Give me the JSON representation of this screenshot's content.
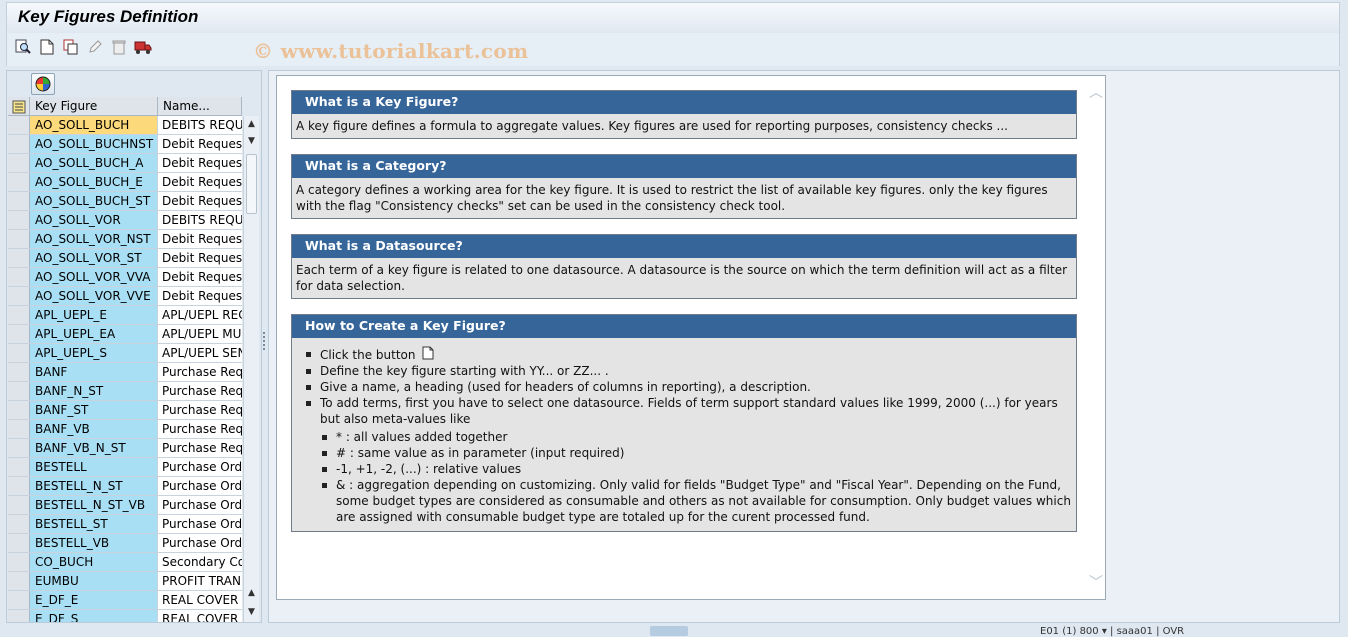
{
  "window": {
    "title": "Key Figures Definition"
  },
  "watermark": "© www.tutorialkart.com",
  "toolbar": {
    "buttons": [
      {
        "name": "find-icon"
      },
      {
        "name": "new-document-icon"
      },
      {
        "name": "copy-icon"
      },
      {
        "name": "edit-pencil-icon"
      },
      {
        "name": "delete-trash-icon"
      },
      {
        "name": "transport-truck-icon"
      }
    ]
  },
  "grid": {
    "columns": [
      "Key Figure",
      "Name..."
    ],
    "rows": [
      {
        "key": "AO_SOLL_BUCH",
        "name": "DEBITS REQU"
      },
      {
        "key": "AO_SOLL_BUCHNST",
        "name": "Debit Request"
      },
      {
        "key": "AO_SOLL_BUCH_A",
        "name": "Debit Request"
      },
      {
        "key": "AO_SOLL_BUCH_E",
        "name": "Debit Request"
      },
      {
        "key": "AO_SOLL_BUCH_ST",
        "name": "Debit Request"
      },
      {
        "key": "AO_SOLL_VOR",
        "name": "DEBITS REQU"
      },
      {
        "key": "AO_SOLL_VOR_NST",
        "name": "Debit Request"
      },
      {
        "key": "AO_SOLL_VOR_ST",
        "name": "Debit Request"
      },
      {
        "key": "AO_SOLL_VOR_VVA",
        "name": "Debit Request"
      },
      {
        "key": "AO_SOLL_VOR_VVE",
        "name": "Debit Request"
      },
      {
        "key": "APL_UEPL_E",
        "name": "APL/UEPL REC"
      },
      {
        "key": "APL_UEPL_EA",
        "name": "APL/UEPL MU"
      },
      {
        "key": "APL_UEPL_S",
        "name": "APL/UEPL SEN"
      },
      {
        "key": "BANF",
        "name": "Purchase Requ"
      },
      {
        "key": "BANF_N_ST",
        "name": "Purchase Requ"
      },
      {
        "key": "BANF_ST",
        "name": "Purchase Requ"
      },
      {
        "key": "BANF_VB",
        "name": "Purchase Requ"
      },
      {
        "key": "BANF_VB_N_ST",
        "name": "Purchase Requ"
      },
      {
        "key": "BESTELL",
        "name": "Purchase Orde"
      },
      {
        "key": "BESTELL_N_ST",
        "name": "Purchase Orde"
      },
      {
        "key": "BESTELL_N_ST_VB",
        "name": "Purchase Orde"
      },
      {
        "key": "BESTELL_ST",
        "name": "Purchase Orde"
      },
      {
        "key": "BESTELL_VB",
        "name": "Purchase Orde"
      },
      {
        "key": "CO_BUCH",
        "name": "Secondary Co"
      },
      {
        "key": "EUMBU",
        "name": "PROFIT TRAN"
      },
      {
        "key": "E_DF_E",
        "name": "REAL COVER I"
      },
      {
        "key": "E_DF_S",
        "name": "REAL COVER I"
      }
    ]
  },
  "help": {
    "s1": {
      "title": "What is a Key Figure?",
      "body": "A key figure defines a formula to aggregate values. Key figures are used for reporting purposes, consistency checks ..."
    },
    "s2": {
      "title": "What is a Category?",
      "body": "A category defines a working area for the key figure. It is used to restrict the list of available key figures. only the key figures with the flag \"Consistency checks\" set can be used in the consistency check tool."
    },
    "s3": {
      "title": "What is a Datasource?",
      "body": "Each term of a key figure is related to one datasource. A datasource is the source on which the term definition will act as a filter for data selection."
    },
    "s4": {
      "title": "How to Create a Key Figure?",
      "step1": "Click the button",
      "step2": "Define the key figure starting with YY... or ZZ... .",
      "step3": "Give a name, a heading (used for headers of columns in reporting), a description.",
      "step4": "To add terms, first you have to select one datasource. Fields of term support standard values like 1999, 2000 (...) for years but also meta-values like",
      "sub1": "* : all values added together",
      "sub2": "# : same value as in parameter (input required)",
      "sub3": "-1, +1, -2, (...) : relative values",
      "sub4": "& : aggregation depending on customizing. Only valid for fields \"Budget Type\" and \"Fiscal Year\". Depending on the Fund, some budget types are considered as consumable and others as not available for consumption. Only budget values which are assigned with consumable budget type are totaled up for the curent processed fund."
    }
  },
  "status": {
    "text": "E01 (1) 800 ▾  |  saaa01  |  OVR"
  }
}
